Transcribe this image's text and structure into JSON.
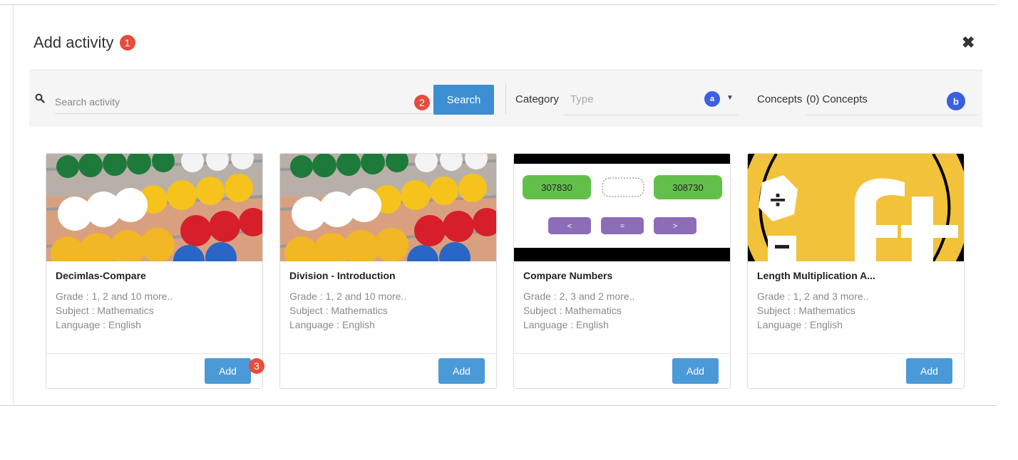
{
  "modal": {
    "title": "Add activity",
    "title_step": "1",
    "close_icon": "close-icon"
  },
  "search": {
    "placeholder": "Search activity",
    "step": "2",
    "button_label": "Search"
  },
  "filters": {
    "category_label": "Category",
    "category_placeholder": "Type",
    "category_badge": "a",
    "concepts_label": "Concepts",
    "concepts_value": "(0) Concepts",
    "concepts_badge": "b"
  },
  "cards": [
    {
      "title": "Decimlas-Compare",
      "grade": "Grade : 1, 2 and 10 more..",
      "subject": "Subject : Mathematics",
      "language": "Language : English",
      "add_label": "Add",
      "image": "abacus"
    },
    {
      "title": "Division - Introduction",
      "grade": "Grade : 1, 2 and 10 more..",
      "subject": "Subject : Mathematics",
      "language": "Language : English",
      "add_label": "Add",
      "image": "abacus"
    },
    {
      "title": "Compare Numbers",
      "grade": "Grade : 2, 3 and 2 more..",
      "subject": "Subject : Mathematics",
      "language": "Language : English",
      "add_label": "Add",
      "image": "compare-numbers",
      "image_text": {
        "left_number": "307830",
        "right_number": "308730",
        "less": "<",
        "equal": "=",
        "greater": ">"
      }
    },
    {
      "title": "Length Multiplication A...",
      "grade": "Grade : 1, 2 and 3 more..",
      "subject": "Subject : Mathematics",
      "language": "Language : English",
      "add_label": "Add",
      "image": "math-logo"
    }
  ],
  "step3": "3",
  "colors": {
    "primary": "#3d8fd1",
    "step_badge": "#e74c3c",
    "filter_badge": "#3b5fe0"
  }
}
